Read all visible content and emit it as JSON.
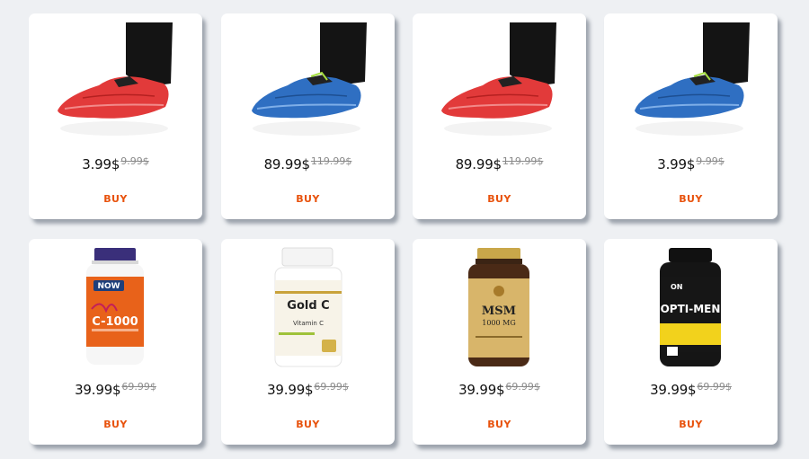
{
  "colors": {
    "buy": "#e8520c",
    "background": "#eef0f3"
  },
  "products": [
    {
      "image": "red-shoe-cover-image",
      "price": "3.99$",
      "old_price": "9.99$",
      "buy_label": "BUY"
    },
    {
      "image": "blue-shoe-cover-image",
      "price": "89.99$",
      "old_price": "119.99$",
      "buy_label": "BUY"
    },
    {
      "image": "red-shoe-cover-image",
      "price": "89.99$",
      "old_price": "119.99$",
      "buy_label": "BUY"
    },
    {
      "image": "blue-shoe-cover-image",
      "price": "3.99$",
      "old_price": "9.99$",
      "buy_label": "BUY"
    },
    {
      "image": "vitamin-c-bottle-image",
      "price": "39.99$",
      "old_price": "69.99$",
      "buy_label": "BUY",
      "label": "C-1000",
      "brand": "NOW"
    },
    {
      "image": "gold-c-bottle-image",
      "price": "39.99$",
      "old_price": "69.99$",
      "buy_label": "BUY",
      "label": "Gold C",
      "sub": "Vitamin C"
    },
    {
      "image": "msm-bottle-image",
      "price": "39.99$",
      "old_price": "69.99$",
      "buy_label": "BUY",
      "label": "MSM",
      "sub": "1000 MG"
    },
    {
      "image": "opti-men-bottle-image",
      "price": "39.99$",
      "old_price": "69.99$",
      "buy_label": "BUY",
      "label": "OPTI-MEN",
      "brand": "ON"
    }
  ]
}
